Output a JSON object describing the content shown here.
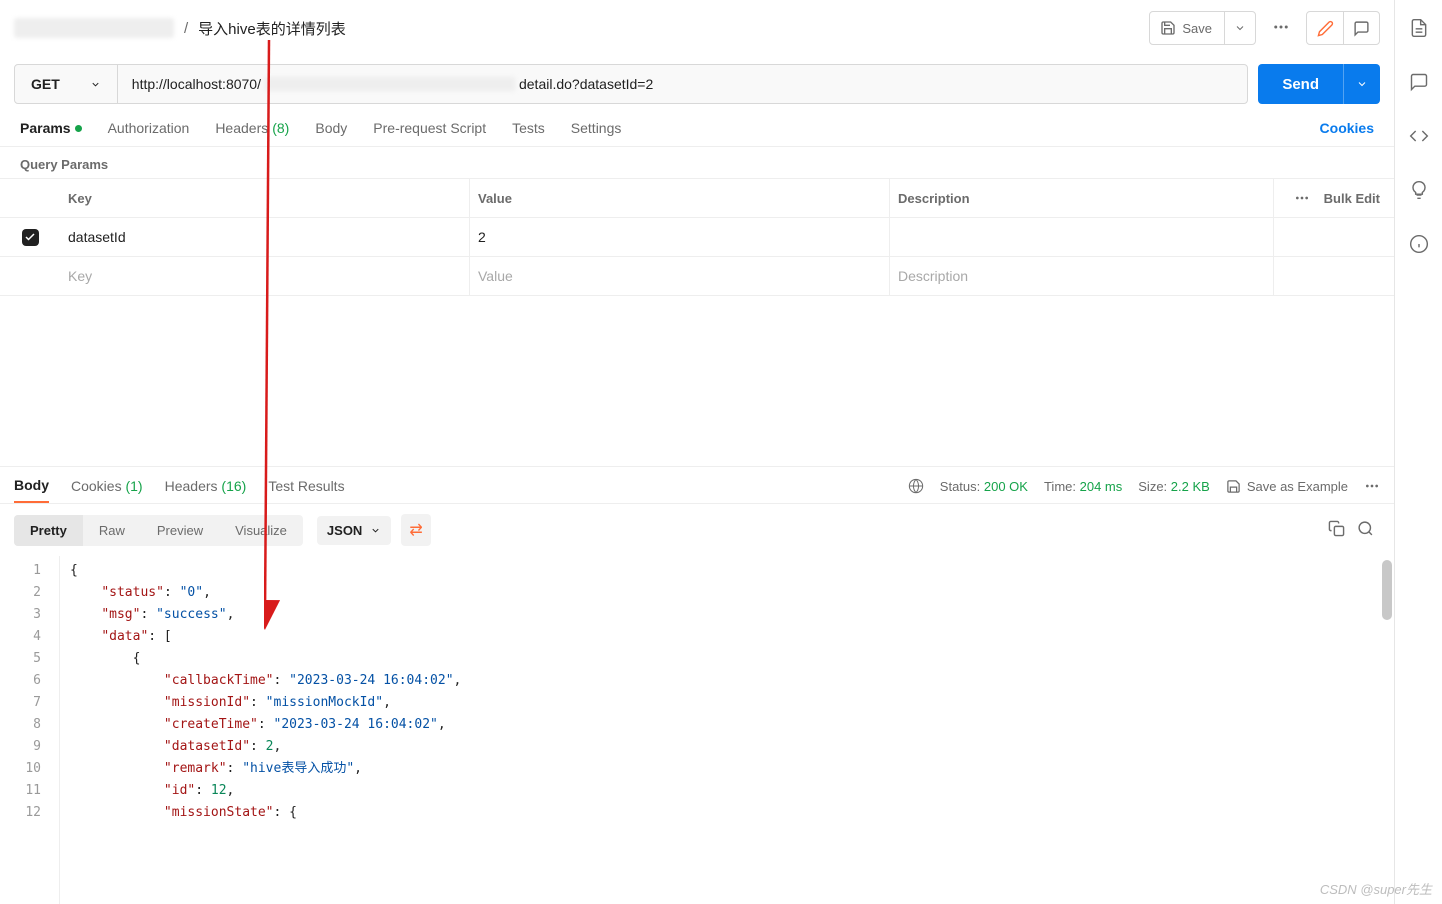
{
  "breadcrumb": {
    "title": "导入hive表的详情列表"
  },
  "topbar": {
    "save_label": "Save"
  },
  "request": {
    "method": "GET",
    "url_prefix": "http://localhost:8070/",
    "url_suffix": "detail.do?datasetId=2",
    "send_label": "Send"
  },
  "req_tabs": {
    "params": "Params",
    "auth": "Authorization",
    "headers": "Headers",
    "headers_count": "(8)",
    "body": "Body",
    "prereq": "Pre-request Script",
    "tests": "Tests",
    "settings": "Settings",
    "cookies_link": "Cookies"
  },
  "query_params": {
    "section": "Query Params",
    "headers": {
      "key": "Key",
      "value": "Value",
      "desc": "Description",
      "bulk": "Bulk Edit"
    },
    "rows": [
      {
        "key": "datasetId",
        "value": "2",
        "desc": ""
      }
    ],
    "placeholders": {
      "key": "Key",
      "value": "Value",
      "desc": "Description"
    }
  },
  "resp_tabs": {
    "body": "Body",
    "cookies": "Cookies",
    "cookies_count": "(1)",
    "headers": "Headers",
    "headers_count": "(16)",
    "test_results": "Test Results"
  },
  "resp_meta": {
    "status_label": "Status:",
    "status_value": "200 OK",
    "time_label": "Time:",
    "time_value": "204 ms",
    "size_label": "Size:",
    "size_value": "2.2 KB",
    "save_example": "Save as Example"
  },
  "resp_toolbar": {
    "pretty": "Pretty",
    "raw": "Raw",
    "preview": "Preview",
    "visualize": "Visualize",
    "format": "JSON"
  },
  "json_lines": [
    {
      "n": 1,
      "html": "<span class='p'>{</span>"
    },
    {
      "n": 2,
      "html": "    <span class='k'>\"status\"</span><span class='p'>: </span><span class='s'>\"0\"</span><span class='p'>,</span>"
    },
    {
      "n": 3,
      "html": "    <span class='k'>\"msg\"</span><span class='p'>: </span><span class='s'>\"success\"</span><span class='p'>,</span>"
    },
    {
      "n": 4,
      "html": "    <span class='k'>\"data\"</span><span class='p'>: [</span>"
    },
    {
      "n": 5,
      "html": "        <span class='p'>{</span>"
    },
    {
      "n": 6,
      "html": "            <span class='k'>\"callbackTime\"</span><span class='p'>: </span><span class='s'>\"2023-03-24 16:04:02\"</span><span class='p'>,</span>"
    },
    {
      "n": 7,
      "html": "            <span class='k'>\"missionId\"</span><span class='p'>: </span><span class='s'>\"missionMockId\"</span><span class='p'>,</span>"
    },
    {
      "n": 8,
      "html": "            <span class='k'>\"createTime\"</span><span class='p'>: </span><span class='s'>\"2023-03-24 16:04:02\"</span><span class='p'>,</span>"
    },
    {
      "n": 9,
      "html": "            <span class='k'>\"datasetId\"</span><span class='p'>: </span><span class='n'>2</span><span class='p'>,</span>"
    },
    {
      "n": 10,
      "html": "            <span class='k'>\"remark\"</span><span class='p'>: </span><span class='s'>\"hive表导入成功\"</span><span class='p'>,</span>"
    },
    {
      "n": 11,
      "html": "            <span class='k'>\"id\"</span><span class='p'>: </span><span class='n'>12</span><span class='p'>,</span>"
    },
    {
      "n": 12,
      "html": "            <span class='k'>\"missionState\"</span><span class='p'>: {</span>"
    }
  ],
  "watermark": "CSDN @super先生"
}
